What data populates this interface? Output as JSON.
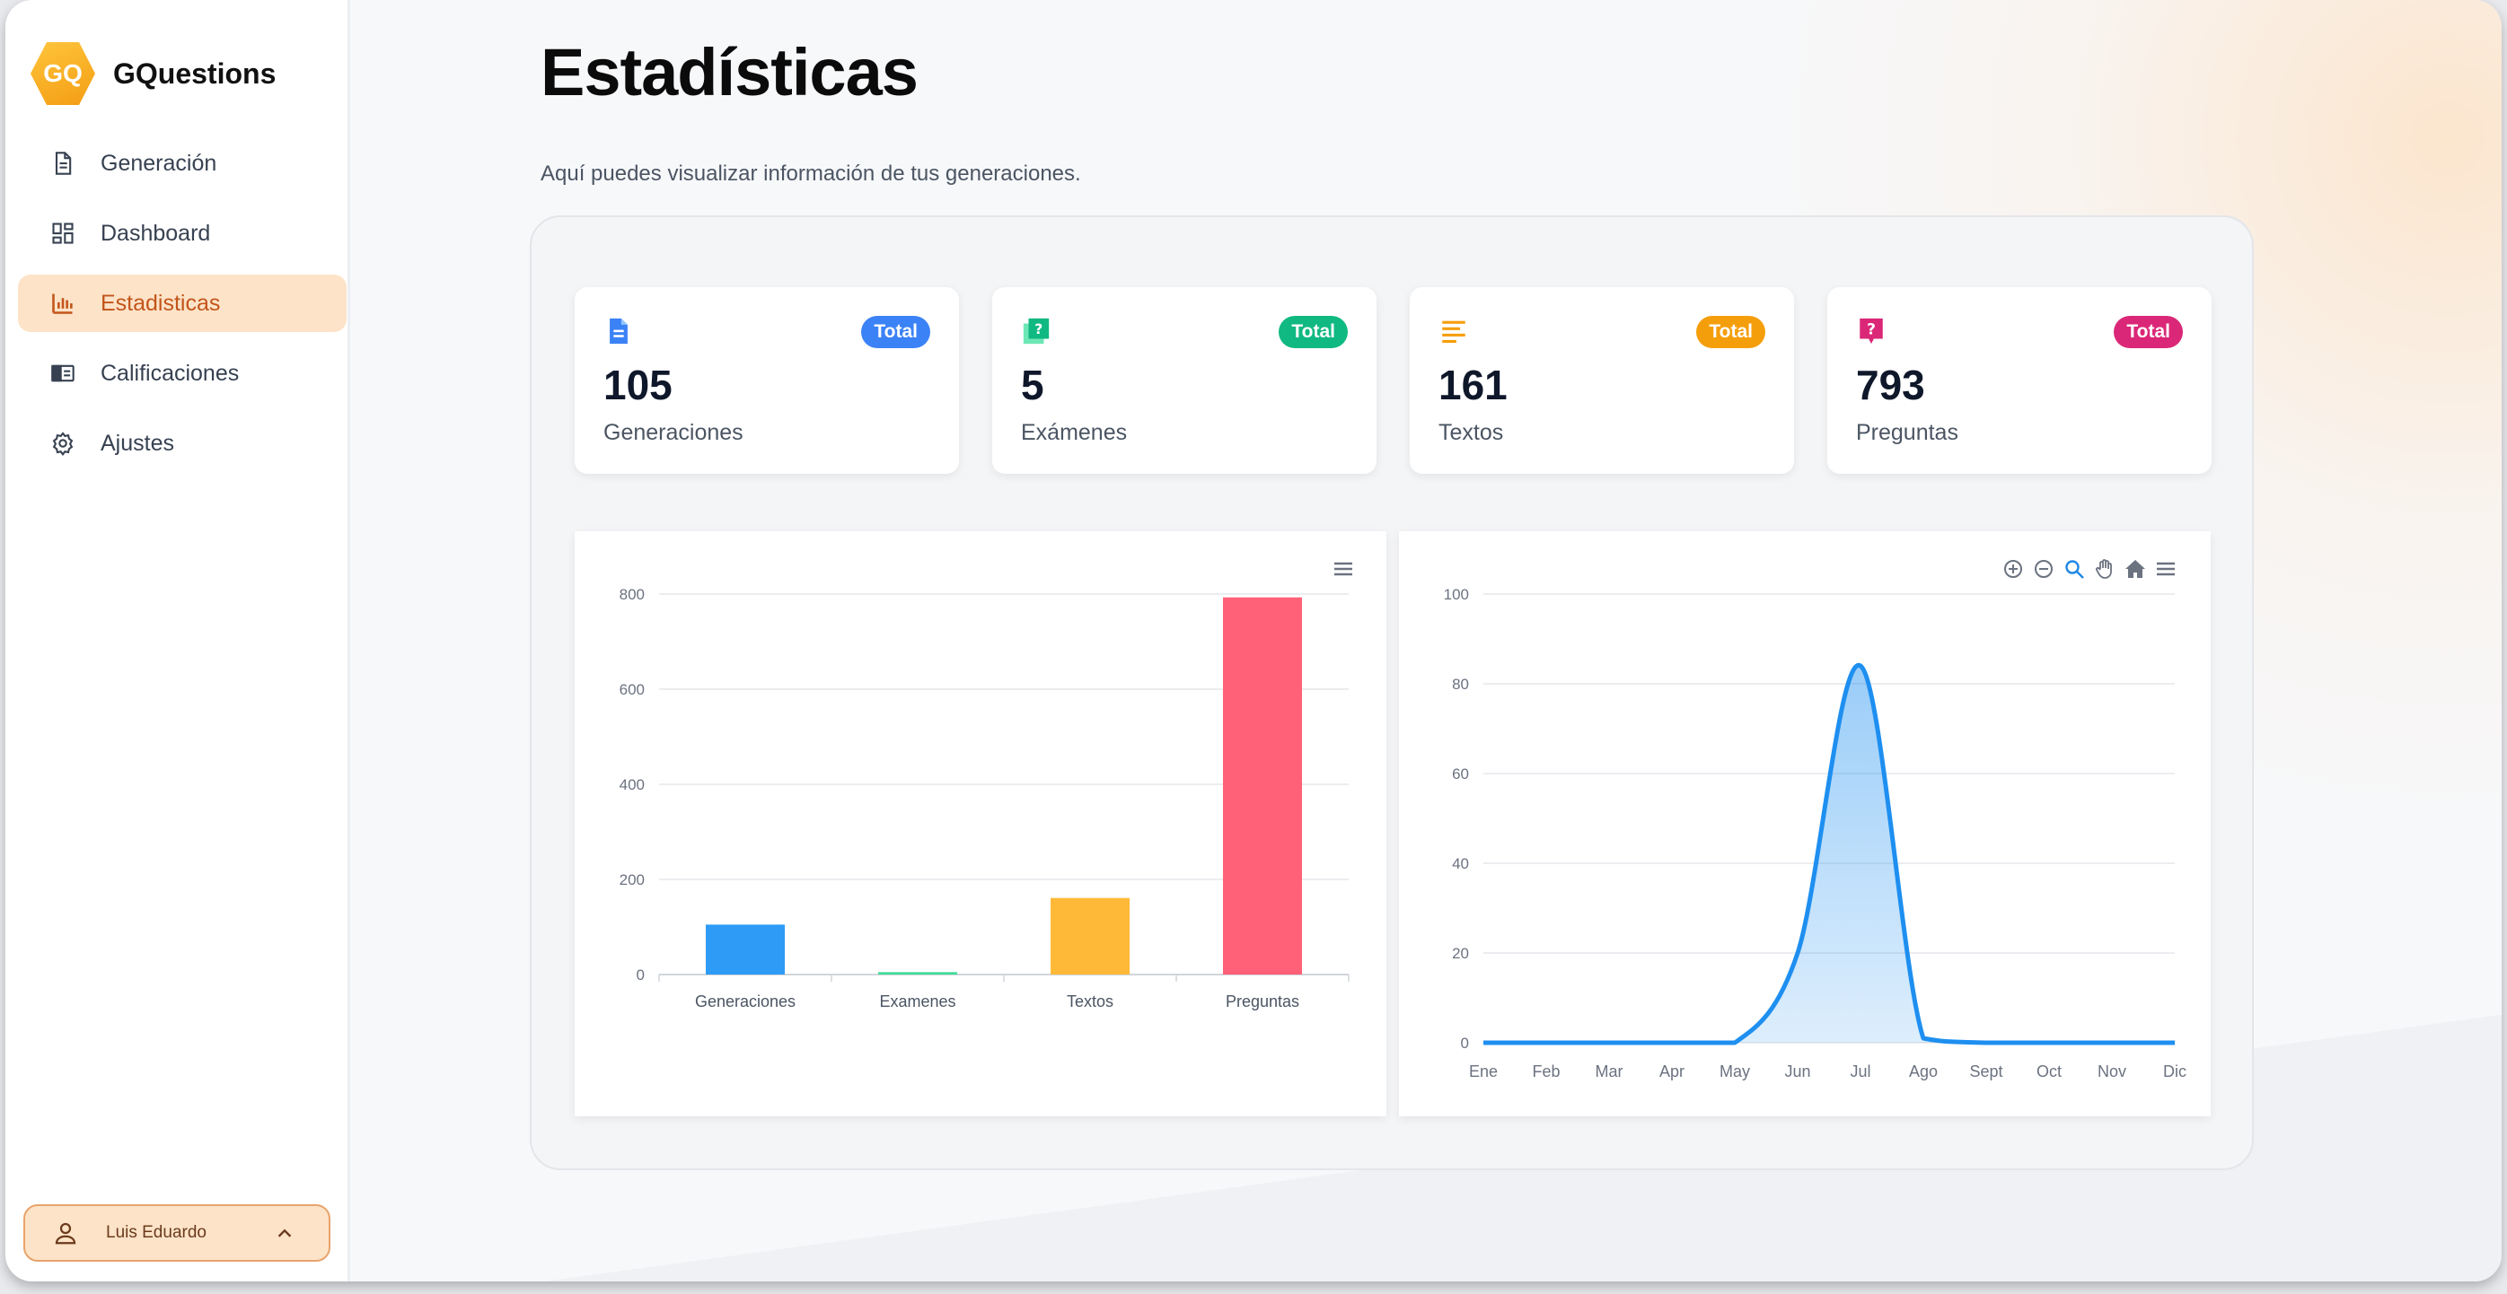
{
  "app": {
    "name": "GQuestions",
    "logo_text": "GQ"
  },
  "sidebar": {
    "items": [
      {
        "label": "Generación",
        "icon": "document-icon",
        "active": false
      },
      {
        "label": "Dashboard",
        "icon": "dashboard-icon",
        "active": false
      },
      {
        "label": "Estadisticas",
        "icon": "bar-chart-icon",
        "active": true
      },
      {
        "label": "Calificaciones",
        "icon": "grades-icon",
        "active": false
      },
      {
        "label": "Ajustes",
        "icon": "gear-icon",
        "active": false
      }
    ],
    "user": {
      "name": "Luis Eduardo"
    }
  },
  "page": {
    "title": "Estadísticas",
    "subtitle": "Aquí puedes visualizar información de tus generaciones."
  },
  "stats": [
    {
      "badge": "Total",
      "value": "105",
      "label": "Generaciones",
      "color": "#3b82f6",
      "icon": "document-icon"
    },
    {
      "badge": "Total",
      "value": "5",
      "label": "Exámenes",
      "color": "#10b981",
      "icon": "exam-icon"
    },
    {
      "badge": "Total",
      "value": "161",
      "label": "Textos",
      "color": "#f59e0b",
      "icon": "text-lines-icon"
    },
    {
      "badge": "Total",
      "value": "793",
      "label": "Preguntas",
      "color": "#db2777",
      "icon": "question-icon"
    }
  ],
  "chart_data": [
    {
      "type": "bar",
      "categories": [
        "Generaciones",
        "Examenes",
        "Textos",
        "Preguntas"
      ],
      "values": [
        105,
        5,
        161,
        793
      ],
      "colors": [
        "#2e9bf6",
        "#3ddc97",
        "#feb938",
        "#ff6178"
      ],
      "ylim": [
        0,
        800
      ],
      "yticks": [
        0,
        200,
        400,
        600,
        800
      ],
      "grid": true,
      "legend": "none"
    },
    {
      "type": "area",
      "categories": [
        "Ene",
        "Feb",
        "Mar",
        "Apr",
        "May",
        "Jun",
        "Jul",
        "Ago",
        "Sept",
        "Oct",
        "Nov",
        "Dic"
      ],
      "values": [
        0,
        0,
        0,
        0,
        0,
        20,
        84,
        1,
        0,
        0,
        0,
        0
      ],
      "color": "#1e8ff0",
      "ylim": [
        0,
        100
      ],
      "yticks": [
        0,
        20,
        40,
        60,
        80,
        100
      ],
      "grid": true,
      "legend": "none"
    }
  ]
}
